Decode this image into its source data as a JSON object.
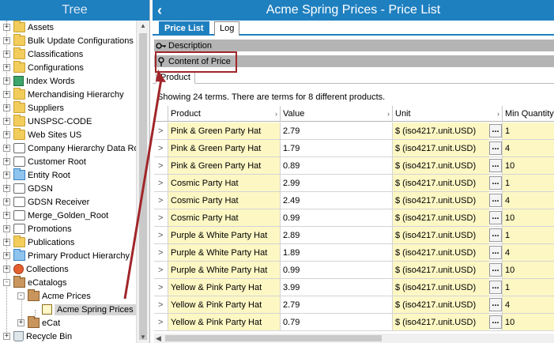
{
  "tree": {
    "title": "Tree",
    "items": [
      {
        "label": "Assets",
        "icon": "folder-icon",
        "toggle": "+"
      },
      {
        "label": "Bulk Update Configurations",
        "icon": "folder-icon",
        "toggle": "+"
      },
      {
        "label": "Classifications",
        "icon": "folder-icon",
        "toggle": "+"
      },
      {
        "label": "Configurations",
        "icon": "folder-icon",
        "toggle": "+"
      },
      {
        "label": "Index Words",
        "icon": "index-words-icon",
        "toggle": "+"
      },
      {
        "label": "Merchandising Hierarchy",
        "icon": "folder-icon",
        "toggle": "+"
      },
      {
        "label": "Suppliers",
        "icon": "folder-icon",
        "toggle": "+"
      },
      {
        "label": "UNSPSC-CODE",
        "icon": "folder-icon",
        "toggle": "+"
      },
      {
        "label": "Web Sites US",
        "icon": "folder-icon",
        "toggle": "+"
      },
      {
        "label": "Company Hierarchy Data Ro",
        "icon": "outline-folder-icon",
        "toggle": "+"
      },
      {
        "label": "Customer Root",
        "icon": "outline-folder-icon",
        "toggle": "+"
      },
      {
        "label": "Entity Root",
        "icon": "blue-folder-icon",
        "toggle": "+"
      },
      {
        "label": "GDSN",
        "icon": "outline-folder-icon",
        "toggle": "+"
      },
      {
        "label": "GDSN Receiver",
        "icon": "outline-folder-icon",
        "toggle": "+"
      },
      {
        "label": "Merge_Golden_Root",
        "icon": "outline-folder-icon",
        "toggle": "+"
      },
      {
        "label": "Promotions",
        "icon": "outline-folder-icon",
        "toggle": "+"
      },
      {
        "label": "Publications",
        "icon": "publications-icon",
        "toggle": "+"
      },
      {
        "label": "Primary Product Hierarchy",
        "icon": "blue-folder-icon",
        "toggle": "+"
      },
      {
        "label": "Collections",
        "icon": "collections-icon",
        "toggle": "+"
      },
      {
        "label": "eCatalogs",
        "icon": "catalog-folder-icon",
        "toggle": "-"
      },
      {
        "label": "Acme Prices",
        "icon": "catalog-folder-icon",
        "toggle": "-"
      },
      {
        "label": "Acme Spring Prices",
        "icon": "price-list-icon",
        "toggle": ""
      },
      {
        "label": "eCat",
        "icon": "catalog-folder-icon",
        "toggle": "+"
      },
      {
        "label": "Recycle Bin",
        "icon": "recycle-bin-icon",
        "toggle": "+"
      }
    ]
  },
  "main": {
    "title": "Acme Spring Prices - Price List",
    "tabs": [
      {
        "label": "Price List",
        "active": true
      },
      {
        "label": "Log",
        "active": false
      }
    ],
    "sections": [
      {
        "label": "Description"
      },
      {
        "label": "Content of Price"
      }
    ],
    "subtab": "Product",
    "summary": "Showing 24 terms. There are terms for 8 different products."
  },
  "table": {
    "columns": [
      "Product",
      "Value",
      "Unit",
      "Min Quantity"
    ],
    "rows": [
      {
        "product": "Pink & Green Party Hat",
        "value": "2.79",
        "unit": "$ (iso4217.unit.USD)",
        "min": "1"
      },
      {
        "product": "Pink & Green Party Hat",
        "value": "1.79",
        "unit": "$ (iso4217.unit.USD)",
        "min": "4"
      },
      {
        "product": "Pink & Green Party Hat",
        "value": "0.89",
        "unit": "$ (iso4217.unit.USD)",
        "min": "10"
      },
      {
        "product": "Cosmic Party Hat",
        "value": "2.99",
        "unit": "$ (iso4217.unit.USD)",
        "min": "1"
      },
      {
        "product": "Cosmic Party Hat",
        "value": "2.49",
        "unit": "$ (iso4217.unit.USD)",
        "min": "4"
      },
      {
        "product": "Cosmic Party Hat",
        "value": "0.99",
        "unit": "$ (iso4217.unit.USD)",
        "min": "10"
      },
      {
        "product": "Purple & White Party Hat",
        "value": "2.89",
        "unit": "$ (iso4217.unit.USD)",
        "min": "1"
      },
      {
        "product": "Purple & White Party Hat",
        "value": "1.89",
        "unit": "$ (iso4217.unit.USD)",
        "min": "4"
      },
      {
        "product": "Purple & White Party Hat",
        "value": "0.99",
        "unit": "$ (iso4217.unit.USD)",
        "min": "10"
      },
      {
        "product": "Yellow & Pink Party Hat",
        "value": "3.99",
        "unit": "$ (iso4217.unit.USD)",
        "min": "1"
      },
      {
        "product": "Yellow & Pink Party Hat",
        "value": "2.79",
        "unit": "$ (iso4217.unit.USD)",
        "min": "4"
      },
      {
        "product": "Yellow & Pink Party Hat",
        "value": "0.79",
        "unit": "$ (iso4217.unit.USD)",
        "min": "10"
      }
    ],
    "row_arrow": ">",
    "ellipsis": "..."
  },
  "colors": {
    "header_blue": "#1f80c0",
    "editable_cell": "#fdf7c4",
    "annotation_red": "#a0262a"
  }
}
